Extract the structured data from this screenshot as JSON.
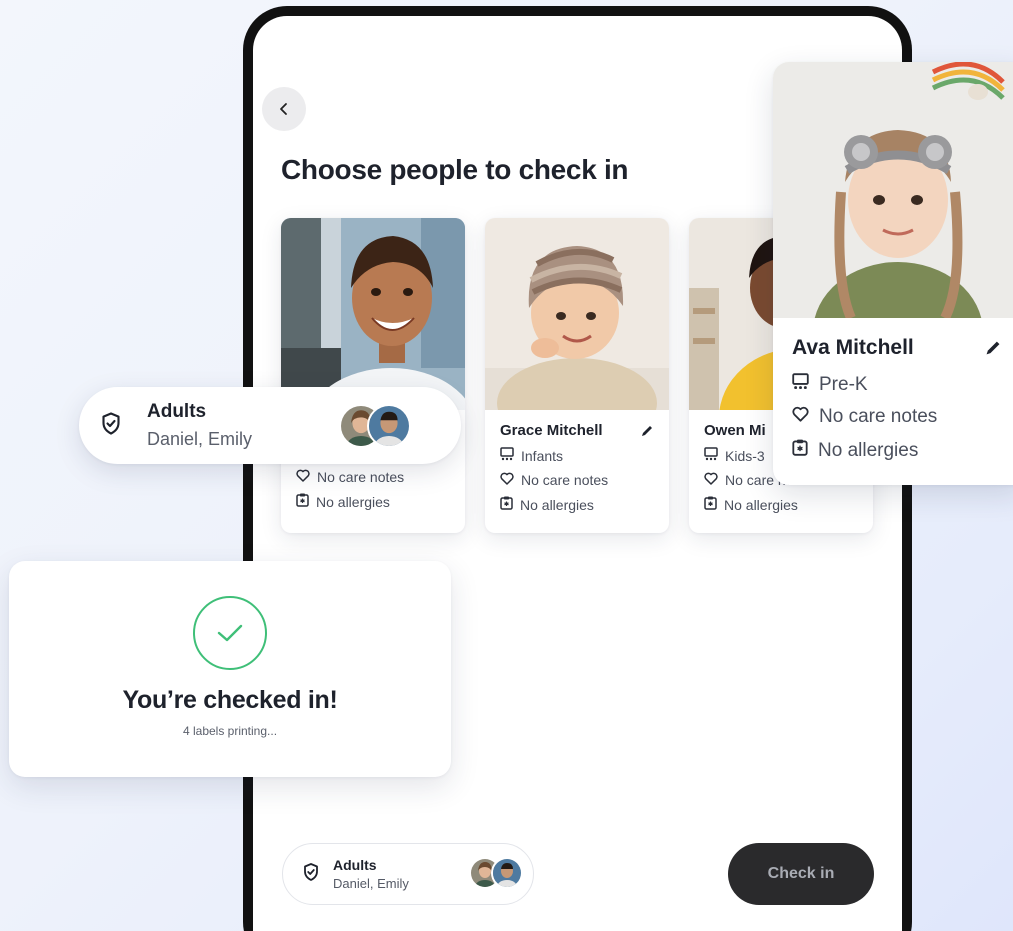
{
  "screen": {
    "title": "Choose people to check in"
  },
  "people": [
    {
      "name": "",
      "group": "",
      "care_notes": "No care notes",
      "allergies": "No allergies"
    },
    {
      "name": "Grace Mitchell",
      "group": "Infants",
      "care_notes": "No care notes",
      "allergies": "No allergies"
    },
    {
      "name": "Owen Mi",
      "group": "Kids-3",
      "care_notes": "No care notes",
      "allergies": "No allergies"
    }
  ],
  "ava_card": {
    "name": "Ava Mitchell",
    "group": "Pre-K",
    "care_notes": "No care notes",
    "allergies": "No allergies"
  },
  "adults": {
    "title": "Adults",
    "names": "Daniel, Emily"
  },
  "checked_in": {
    "title": "You’re checked in!",
    "subtitle": "4 labels printing..."
  },
  "actions": {
    "check_in_label": "Check in"
  },
  "icons": {
    "back": "chevron-left-icon",
    "edit": "pencil-icon",
    "group": "classroom-icon",
    "care": "heart-icon",
    "allergy": "clipboard-icon",
    "shield": "shield-check-icon",
    "success": "check-circle-icon"
  },
  "colors": {
    "success": "#3fbf78",
    "button_dark": "#2a2a2c",
    "frame": "#111111"
  }
}
